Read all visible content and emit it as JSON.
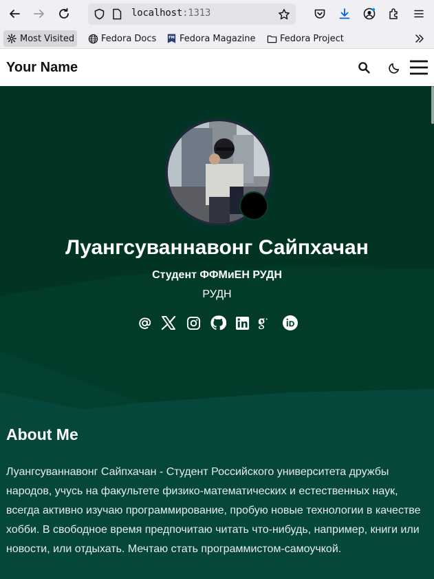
{
  "browser": {
    "url_host": "localhost",
    "url_port": ":1313",
    "bookmarks": [
      {
        "label": "Most Visited",
        "icon": "gear-icon"
      },
      {
        "label": "Fedora Docs",
        "icon": "globe-icon"
      },
      {
        "label": "Fedora Magazine",
        "icon": "fedora-magazine-icon"
      },
      {
        "label": "Fedora Project",
        "icon": "folder-icon"
      }
    ],
    "overflow_icon": "chevron-double-right-icon"
  },
  "site": {
    "brand": "Your Name",
    "header_icons": [
      "search-icon",
      "moon-icon",
      "hamburger-menu-icon"
    ]
  },
  "profile": {
    "name": "Луангсуваннавонг Сайпхачан",
    "role": "Студент ФФМиЕН РУДН",
    "organization": "РУДН",
    "socials": [
      "email-at-icon",
      "x-twitter-icon",
      "instagram-icon",
      "github-icon",
      "linkedin-icon",
      "google-scholar-icon",
      "orcid-icon"
    ]
  },
  "about": {
    "title": "About Me",
    "text": "Луангсуваннавонг Сайпхачан - Студент Российского университета дружбы народов, учусь на факультете физико-математических и естественных наук, всегда активно изучаю программирование, пробую новые технологии в качестве хобби. В свободное время предпочитаю читать что-нибудь, например, книги или новости, или отдыхать. Мечтаю стать программистом-самоучкой."
  },
  "colors": {
    "hero_bg": "#023d2c",
    "hero_band": "#064a39",
    "browser_bg": "#f0f0f4",
    "download_accent": "#0060df"
  }
}
